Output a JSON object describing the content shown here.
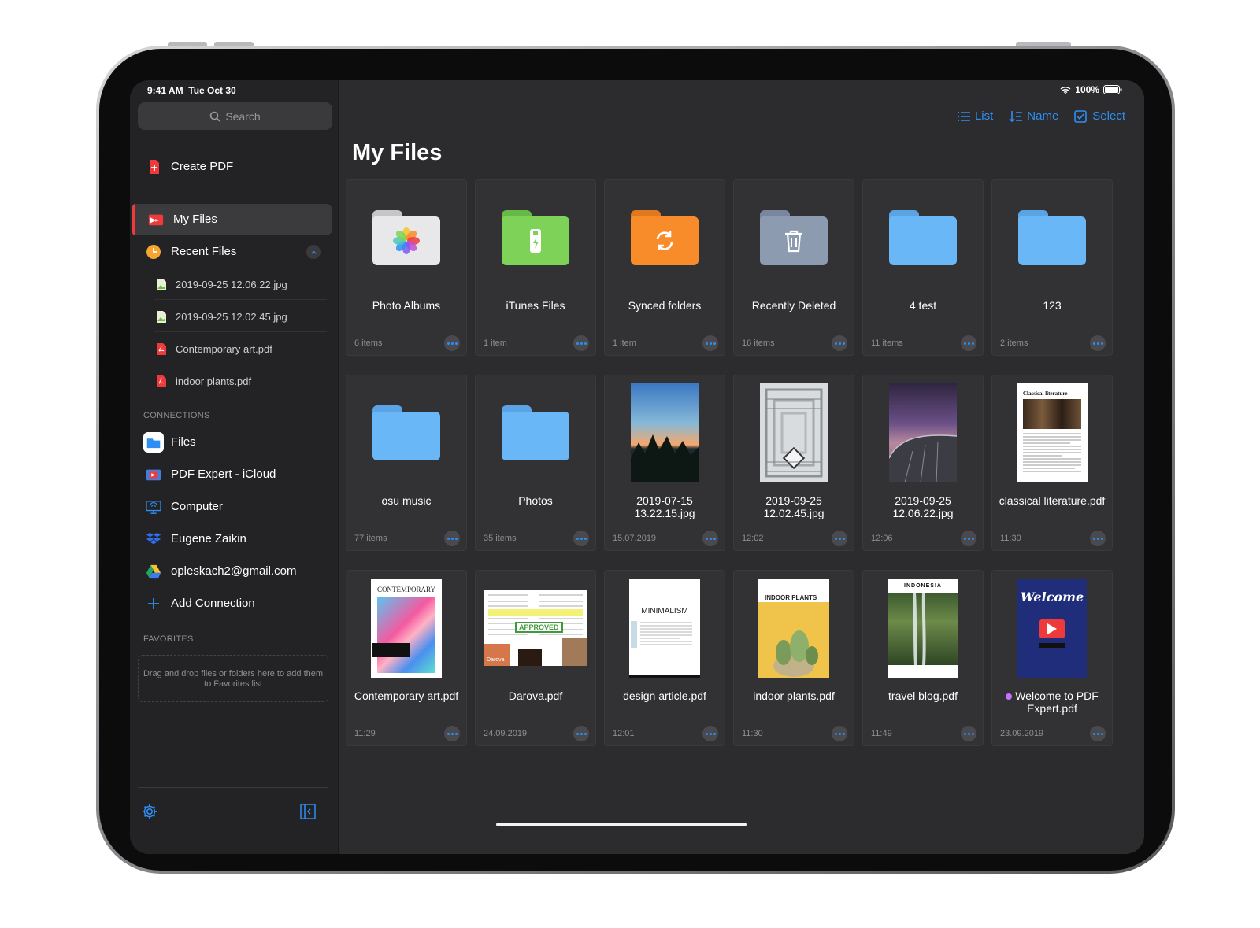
{
  "status": {
    "time": "9:41 AM",
    "date": "Tue Oct 30",
    "battery": "100%"
  },
  "sidebar": {
    "search_placeholder": "Search",
    "create_pdf": "Create PDF",
    "my_files": "My Files",
    "recent_files": "Recent Files",
    "recent": [
      "2019-09-25 12.06.22.jpg",
      "2019-09-25 12.02.45.jpg",
      "Contemporary art.pdf",
      "indoor plants.pdf"
    ],
    "connections_header": "CONNECTIONS",
    "connections": [
      "Files",
      "PDF Expert - iCloud",
      "Computer",
      "Eugene Zaikin",
      "opleskach2@gmail.com",
      "Add Connection"
    ],
    "favorites_header": "FAVORITES",
    "favorites_hint": "Drag and drop files or folders here to add them to Favorites list"
  },
  "toolbar": {
    "list": "List",
    "name": "Name",
    "select": "Select"
  },
  "title": "My Files",
  "files": [
    {
      "name": "Photo Albums",
      "meta": "6 items",
      "kind": "folder-photos"
    },
    {
      "name": "iTunes Files",
      "meta": "1 item",
      "kind": "folder-itunes"
    },
    {
      "name": "Synced folders",
      "meta": "1 item",
      "kind": "folder-synced"
    },
    {
      "name": "Recently Deleted",
      "meta": "16 items",
      "kind": "folder-deleted"
    },
    {
      "name": "4 test",
      "meta": "11 items",
      "kind": "folder"
    },
    {
      "name": "123",
      "meta": "2 items",
      "kind": "folder"
    },
    {
      "name": "osu music",
      "meta": "77 items",
      "kind": "folder"
    },
    {
      "name": "Photos",
      "meta": "35 items",
      "kind": "folder"
    },
    {
      "name": "2019-07-15 13.22.15.jpg",
      "meta": "15.07.2019",
      "kind": "img-sunset"
    },
    {
      "name": "2019-09-25 12.02.45.jpg",
      "meta": "12:02",
      "kind": "img-library"
    },
    {
      "name": "2019-09-25 12.06.22.jpg",
      "meta": "12:06",
      "kind": "img-dome"
    },
    {
      "name": "classical literature.pdf",
      "meta": "11:30",
      "kind": "doc-classical"
    },
    {
      "name": "Contemporary art.pdf",
      "meta": "11:29",
      "kind": "doc-contemporary"
    },
    {
      "name": "Darova.pdf",
      "meta": "24.09.2019",
      "kind": "doc-darova"
    },
    {
      "name": "design article.pdf",
      "meta": "12:01",
      "kind": "doc-minimalism"
    },
    {
      "name": "indoor plants.pdf",
      "meta": "11:30",
      "kind": "doc-plants"
    },
    {
      "name": "travel blog.pdf",
      "meta": "11:49",
      "kind": "doc-travel"
    },
    {
      "name": "Welcome to PDF Expert.pdf",
      "meta": "23.09.2019",
      "kind": "doc-welcome"
    }
  ],
  "thumb_text": {
    "contemporary": "CONTEMPORARY",
    "approved": "APPROVED",
    "darova": "Darova",
    "minimalism": "MINIMALISM",
    "indoor_plants": "INDOOR PLANTS",
    "indonesia": "INDONESIA",
    "welcome": "Welcome",
    "classical": "Classical literature"
  },
  "colors": {
    "accent": "#2d8ff5",
    "folder_blue": "#6ab7f7",
    "itunes_green": "#7ed257",
    "synced_orange": "#f98c2a",
    "deleted_gray": "#8d9bb0",
    "pdf_red": "#ef3a3c"
  }
}
